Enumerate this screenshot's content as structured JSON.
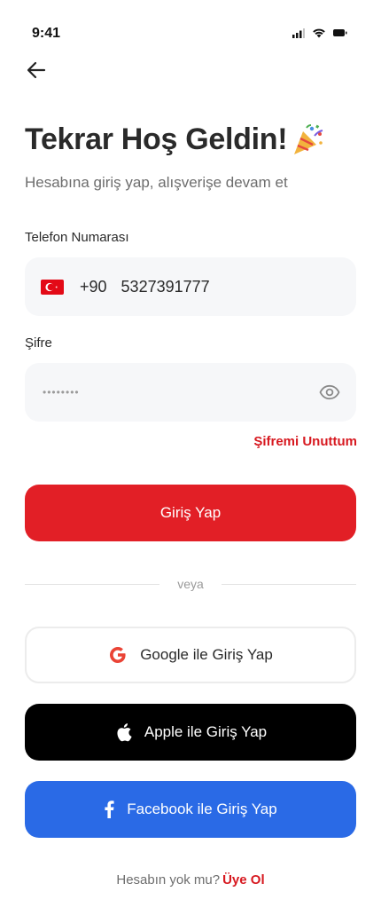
{
  "status": {
    "time": "9:41"
  },
  "header": {
    "title": "Tekrar Hoş Geldin!",
    "subtitle": "Hesabına giriş yap, alışverişe devam et"
  },
  "phone": {
    "label": "Telefon Numarası",
    "country_code": "+90",
    "value": "5327391777",
    "flag": "turkey-flag"
  },
  "password": {
    "label": "Şifre",
    "value": "••••••••",
    "visibility_icon": "eye-icon"
  },
  "forgot_label": "Şifremi Unuttum",
  "login_label": "Giriş Yap",
  "divider_label": "veya",
  "social": {
    "google_label": "Google ile Giriş Yap",
    "apple_label": "Apple ile Giriş Yap",
    "facebook_label": "Facebook ile Giriş Yap"
  },
  "footer": {
    "prompt": "Hesabın yok mu?",
    "signup_label": "Üye Ol"
  },
  "colors": {
    "accent": "#e21f26",
    "link": "#d71920",
    "facebook": "#2a6ae6",
    "apple": "#000000",
    "field_bg": "#f6f7f9"
  }
}
